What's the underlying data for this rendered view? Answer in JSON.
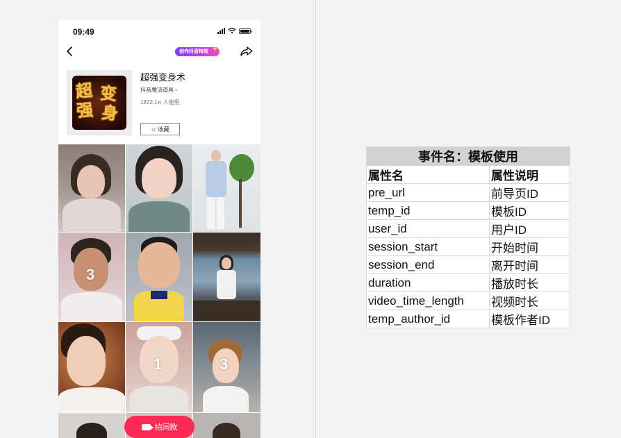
{
  "status_bar": {
    "time": "09:49"
  },
  "nav": {
    "badge": "创作抖音特效"
  },
  "effect": {
    "thumb_text": [
      "超",
      "变",
      "强",
      "身"
    ],
    "title": "超强变身术",
    "category": "抖音魔法道具",
    "usage": "1822.1w 人使用",
    "favorite_label": "收藏"
  },
  "grid": {
    "numbers": [
      "3",
      "1",
      "3"
    ]
  },
  "shoot_button": {
    "label": "拍同款"
  },
  "event_table": {
    "caption": "事件名：模板使用",
    "headers": [
      "属性名",
      "属性说明"
    ],
    "rows": [
      [
        "pre_url",
        "前导页ID"
      ],
      [
        "temp_id",
        "模板ID"
      ],
      [
        "user_id",
        "用户ID"
      ],
      [
        "session_start",
        "开始时间"
      ],
      [
        "session_end",
        "离开时间"
      ],
      [
        "duration",
        "播放时长"
      ],
      [
        "video_time_length",
        "视频时长"
      ],
      [
        "temp_author_id",
        "模板作者ID"
      ]
    ]
  },
  "colors": {
    "accent": "#fe2c55",
    "badge_start": "#7b3ff2",
    "badge_end": "#e94cc4",
    "table_caption_bg": "#d2d2d2"
  },
  "icons": [
    "back-icon",
    "share-icon",
    "star-icon",
    "camera-icon",
    "signal-icon",
    "wifi-icon",
    "battery-icon"
  ]
}
